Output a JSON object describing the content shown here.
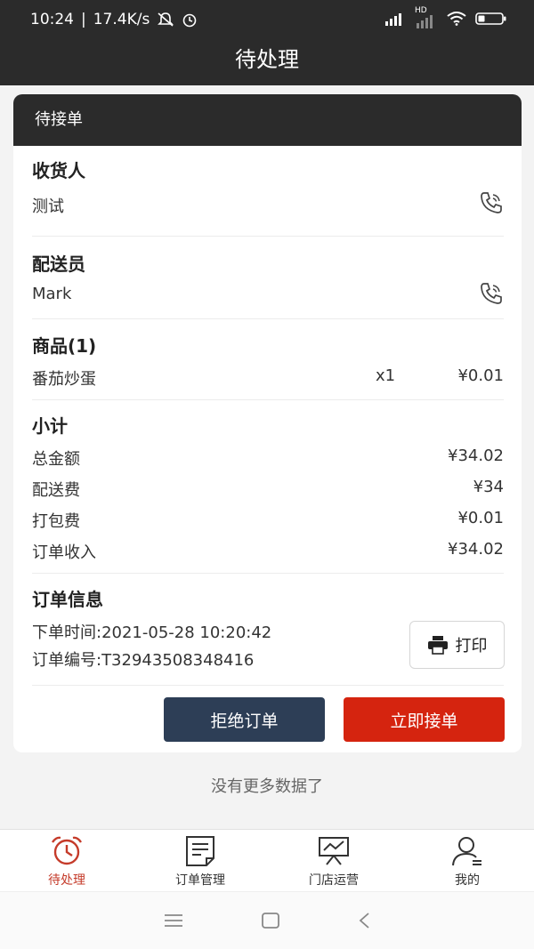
{
  "status_bar": {
    "time": "10:24",
    "speed": "17.4K/s",
    "hd_label": "HD"
  },
  "app_bar": {
    "title": "待处理"
  },
  "card": {
    "header": "待接单",
    "receiver": {
      "title": "收货人",
      "name": "测试"
    },
    "courier": {
      "title": "配送员",
      "name": "Mark"
    },
    "goods": {
      "title": "商品(1)",
      "items": [
        {
          "name": "番茄炒蛋",
          "qty": "x1",
          "price": "¥0.01"
        }
      ]
    },
    "subtotal": {
      "title": "小计",
      "rows": [
        {
          "label": "总金额",
          "value": "¥34.02"
        },
        {
          "label": "配送费",
          "value": "¥34"
        },
        {
          "label": "打包费",
          "value": "¥0.01"
        },
        {
          "label": "订单收入",
          "value": "¥34.02"
        }
      ]
    },
    "order_info": {
      "title": "订单信息",
      "time": "下单时间:2021-05-28 10:20:42",
      "number": "订单编号:T32943508348416",
      "print_label": "打印"
    },
    "actions": {
      "reject_label": "拒绝订单",
      "accept_label": "立即接单"
    }
  },
  "no_more": "没有更多数据了",
  "tab_bar": {
    "items": [
      {
        "label": "待处理",
        "icon": "alarm-clock-icon",
        "active": true
      },
      {
        "label": "订单管理",
        "icon": "document-icon",
        "active": false
      },
      {
        "label": "门店运营",
        "icon": "chart-board-icon",
        "active": false
      },
      {
        "label": "我的",
        "icon": "user-icon",
        "active": false
      }
    ]
  },
  "colors": {
    "header_dark": "#2b2b2b",
    "reject": "#2d3e56",
    "accept": "#d5240f",
    "active_tab": "#c53b2a"
  }
}
